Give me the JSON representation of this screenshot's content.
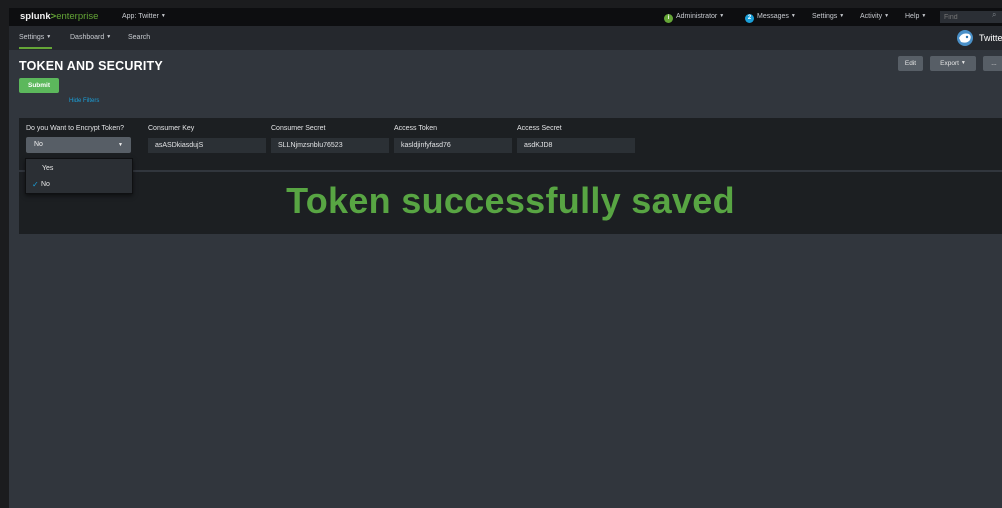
{
  "topbar": {
    "logo_main": "splunk",
    "logo_gt": ">",
    "logo_sub": "enterprise",
    "app_label": "App: Twitter",
    "administrator": "Administrator",
    "messages_count": "2",
    "messages": "Messages",
    "settings": "Settings",
    "activity": "Activity",
    "help": "Help",
    "find_placeholder": "Find",
    "admin_badge": "i",
    "admin_color": "#65a637",
    "messages_color": "#1a9fd8"
  },
  "appnav": {
    "settings": "Settings",
    "dashboard": "Dashboard",
    "search": "Search",
    "app_name": "Twitter"
  },
  "page": {
    "title": "TOKEN AND SECURITY",
    "submit": "Submit",
    "hide_filters": "Hide Filters",
    "edit": "Edit",
    "export": "Export",
    "more": "..."
  },
  "filters": {
    "encrypt_label": "Do you Want to Encrypt Token?",
    "encrypt_value": "No",
    "consumer_key_label": "Consumer Key",
    "consumer_key_value": "asASDkiasdujS",
    "consumer_secret_label": "Consumer Secret",
    "consumer_secret_value": "SLLNjmzsnblu76523",
    "access_token_label": "Access Token",
    "access_token_value": "kasldjinfyfasd76",
    "access_secret_label": "Access Secret",
    "access_secret_value": "asdKJD8"
  },
  "dropdown": {
    "options": [
      "Yes",
      "No"
    ],
    "selected": "No"
  },
  "panel": {
    "message": "Token successfully saved",
    "message_color": "#58a543"
  },
  "accent": {
    "primary": "#5cb85c",
    "link": "#1a9fd8"
  }
}
